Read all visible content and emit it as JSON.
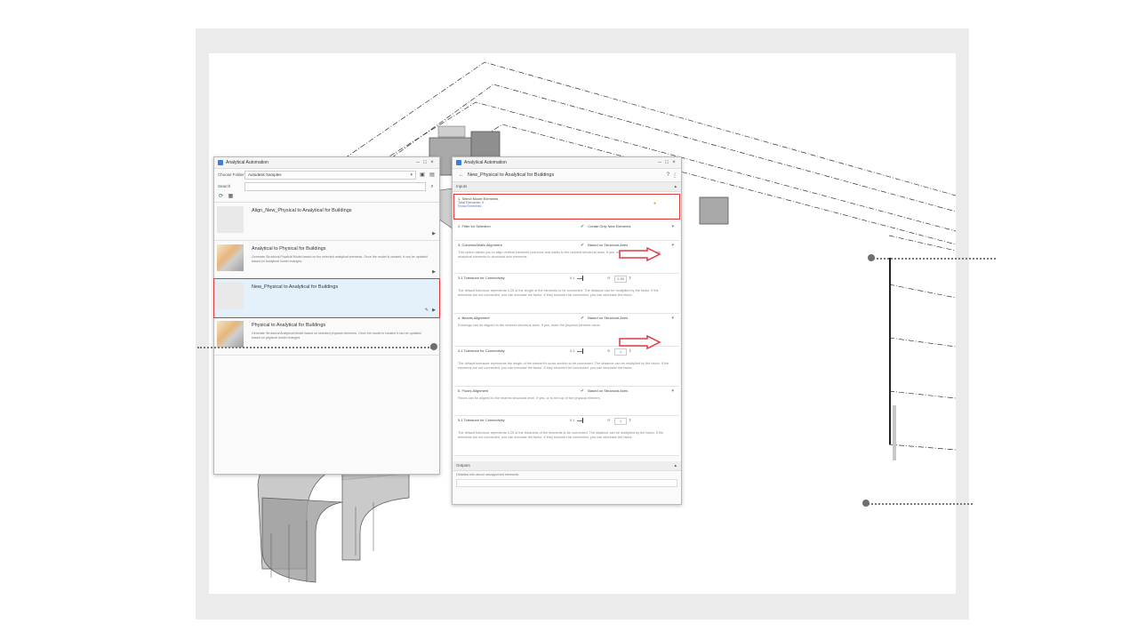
{
  "colors": {
    "highlight": "#e03b3b",
    "selected_bg": "#e4f1fb",
    "accent": "#3b7ddd",
    "check": "#2f9a3a",
    "warning": "#e3a21a"
  },
  "left_panel": {
    "title": "Analytical Automation",
    "choose_folder_label": "Choose Folder",
    "folder_value": "Autodesk Samples",
    "search_label": "Search",
    "workflows": [
      {
        "name": "Align_New_Physical to Analytical for Buildings",
        "description": ""
      },
      {
        "name": "Analytical to Physical for Buildings",
        "description": "Generate Structural Physical Model based on the selected analytical elements. Once the model is created, it can be updated based on analytical model changes."
      },
      {
        "name": "New_Physical to Analytical for Buildings",
        "description": ""
      },
      {
        "name": "Physical to Analytical for Buildings",
        "description": "Generate Structural Analytical Model based on selected physical elements. Once the model is created it can be updated based on physical model changes."
      }
    ]
  },
  "right_panel": {
    "title": "Analytical Automation",
    "workflow_title": "New_Physical to Analytical for Buildings",
    "inputs_label": "Inputs",
    "outputs_label": "Outputs",
    "steps": [
      {
        "title": "1. Select Model Elements",
        "sub": "Total Elements: 0",
        "link": "Show Elements"
      },
      {
        "title": "2. Filter for Selection",
        "value": "Create Only New Elements"
      },
      {
        "title": "3. Columns/Walls Alignment",
        "value": "Based on Structural Axes",
        "description": "This option allows you to align vertical elements (columns and walls) to the nearest structural axes. If yes, we'll match the location of the analytical elements to structural axis elements."
      },
      {
        "title": "3.1 Tolerance for Connectivity",
        "slider_label": "0.1",
        "slider_value": "0.35",
        "description": "The default tolerance represents 0.25 of the length of the elements to be connected. The distance can be multiplied by the factor. If the elements are not connected, you can increase the factor. If they shouldn't be connected, you can decrease the factor."
      },
      {
        "title": "4. Beams Alignment",
        "value": "Based on Structural Axes",
        "description": "Framings can be aligned to the nearest structural axes. If yes, enter the physical element name."
      },
      {
        "title": "4.1 Tolerance for Connectivity",
        "slider_label": "0.1",
        "slider_value": "1",
        "description": "The default tolerance represents the length of the element's cross-section to be connected. The distance can be multiplied by the factor. If the elements are not connected, you can increase the factor. If they shouldn't be connected, you can decrease the factor."
      },
      {
        "title": "5. Floors Alignment",
        "value": "Based on Structural Axes",
        "description": "Floors can be aligned to the nearest structural level. If yes, or to the top of the physical element."
      },
      {
        "title": "5.1 Tolerance for Connectivity",
        "slider_label": "0.1",
        "slider_value": "1",
        "description": "The default tolerance represents 0.25 of the thickness of the elements to be connected. The distance can be multiplied by the factor. If the elements are not connected, you can increase the factor. If they shouldn't be connected, you can decrease the factor."
      }
    ],
    "outputs_field_label": "Detailed info about unsupported elements"
  }
}
